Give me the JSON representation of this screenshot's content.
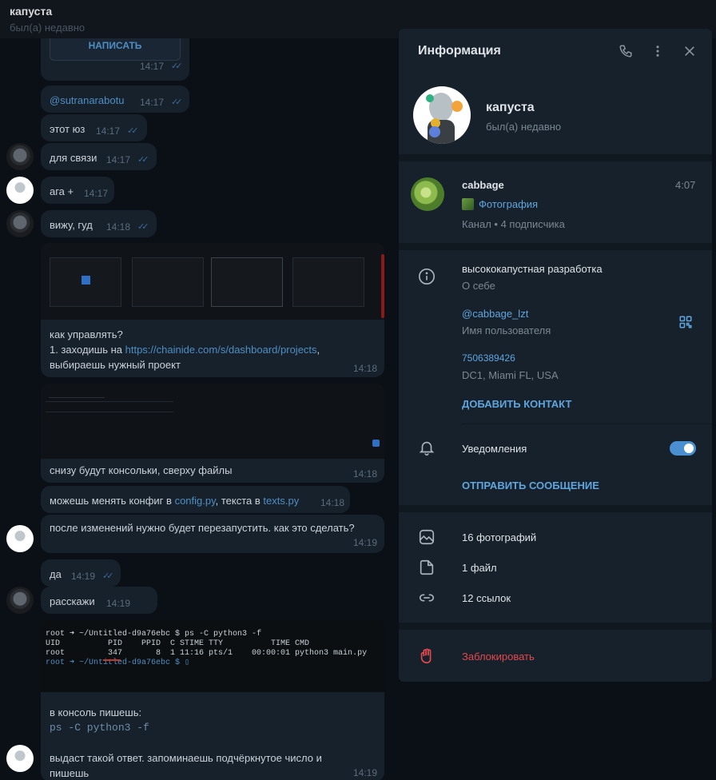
{
  "header": {
    "name": "капуста",
    "status": "был(а) недавно"
  },
  "messages": {
    "write_button": "НАПИСАТЬ",
    "m1_time": "14:17",
    "m2_text": "@sutranarabotu",
    "m2_time": "14:17",
    "m3_text": "этот юз",
    "m3_time": "14:17",
    "m4_text": "для связи",
    "m4_time": "14:17",
    "m5_text": "ага +",
    "m5_time": "14:17",
    "m6_text": "вижу, гуд",
    "m6_time": "14:18",
    "m7_line1": "как управлять?",
    "m7_line2_prefix": "1. заходишь на ",
    "m7_link": "https://chainide.com/s/dashboard/projects",
    "m7_line2_suffix": ",",
    "m7_line3": "выбираешь нужный проект",
    "m7_time": "14:18",
    "m8_text": "снизу будут консольки, сверху файлы",
    "m8_time": "14:18",
    "m9_prefix": "можешь менять конфиг в ",
    "m9_link1": "config.py",
    "m9_mid": ", текста в ",
    "m9_link2": "texts.py",
    "m9_time": "14:18",
    "m10_text": "после изменений нужно будет перезапустить. как это сделать?",
    "m10_time": "14:19",
    "m11_text": "да",
    "m11_time": "14:19",
    "m12_text": "расскажи",
    "m12_time": "14:19",
    "m13_line1": "в консоль пишешь:",
    "m13_code": "ps -C python3 -f",
    "m13_line3": "выдаст такой ответ. запоминаешь подчёркнутое число и",
    "m13_line4": "пишешь",
    "m13_time": "14:19",
    "terminal": {
      "line1": "root ➜ ~/Untitled-d9a76ebc $ ps -C python3 -f",
      "line2": "UID          PID    PPID  C STIME TTY          TIME CMD",
      "line3": "root         347       8  1 11:16 pts/1    00:00:01 python3 main.py",
      "line4": "root ➜ ~/Untitled-d9a76ebc $ ▯"
    }
  },
  "panel": {
    "title": "Информация",
    "profile_name": "капуста",
    "profile_status": "был(а) недавно",
    "channel_name": "cabbage",
    "channel_time": "4:07",
    "channel_media": "Фотография",
    "channel_sub": "Канал • 4 подписчика",
    "bio": "высококапустная разработка",
    "bio_label": "О себе",
    "username": "@cabbage_lzt",
    "username_label": "Имя пользователя",
    "phone": "7506389426",
    "location": "DC1, Miami FL, USA",
    "add_contact": "ДОБАВИТЬ КОНТАКТ",
    "notifications": "Уведомления",
    "send_message": "ОТПРАВИТЬ СООБЩЕНИЕ",
    "photos": "16 фотографий",
    "files": "1 файл",
    "links": "12 ссылок",
    "block": "Заблокировать"
  },
  "colors": {
    "accent": "#5fa5de",
    "danger": "#e5484d",
    "toggle": "#4a8fd0"
  }
}
